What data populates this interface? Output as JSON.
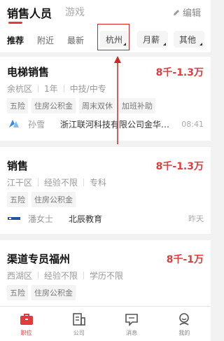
{
  "header": {
    "tab_active": "销售人员",
    "tab_inactive": "游戏",
    "edit_label": "编辑"
  },
  "filters": {
    "tabs": [
      "推荐",
      "附近",
      "最新"
    ],
    "pills": [
      "杭州",
      "月薪",
      "其他"
    ]
  },
  "jobs": [
    {
      "title": "电梯销售",
      "salary": "8千-1.3万",
      "meta": [
        "余杭区",
        "1年",
        "中技/中专"
      ],
      "tags": [
        "五险",
        "住房公积金",
        "周末双休",
        "加班补助"
      ],
      "recruiter": "孙雪",
      "company": "浙江联河科技有限公司金华…",
      "time": "08:41"
    },
    {
      "title": "销售",
      "salary": "8千-1.3万",
      "meta": [
        "江干区",
        "经验不限",
        "专科"
      ],
      "tags": [
        "五险",
        "住房公积金"
      ],
      "recruiter": "潘女士",
      "company": "北辰教育",
      "time": "昨天"
    },
    {
      "title": "渠道专员福州",
      "salary": "8千-1万",
      "meta": [
        "西湖区",
        "经验不限",
        "学历不限"
      ],
      "tags": [
        "五险",
        "住房公积金"
      ]
    }
  ],
  "bottom_nav": [
    {
      "label": "职位",
      "icon": "briefcase-icon",
      "active": true
    },
    {
      "label": "公司",
      "icon": "company-icon",
      "active": false
    },
    {
      "label": "消息",
      "icon": "message-icon",
      "active": false
    },
    {
      "label": "我的",
      "icon": "profile-icon",
      "active": false
    }
  ],
  "colors": {
    "accent": "#e23b3b",
    "annotation": "#d42424"
  }
}
